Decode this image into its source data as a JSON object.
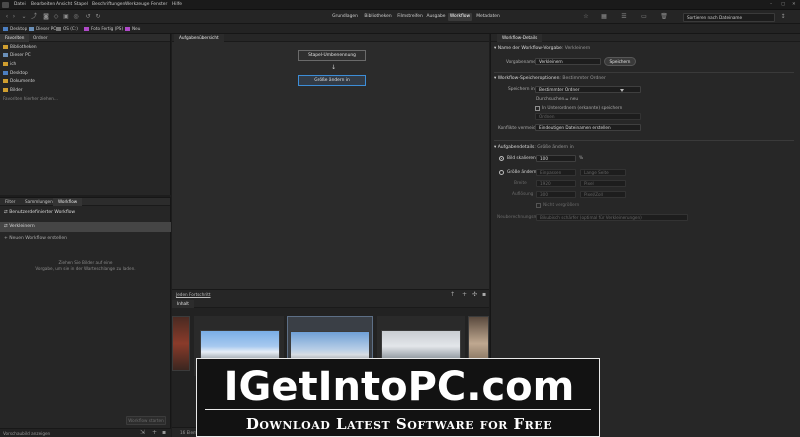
{
  "menubar": {
    "items": [
      "Datei",
      "Bearbeiten",
      "Ansicht",
      "Stapel",
      "Beschriftungen",
      "Werkzeuge",
      "Fenster",
      "Hilfe"
    ]
  },
  "toolbar": {
    "workspaces": [
      "Grundlagen",
      "Bibliotheken",
      "Filmstreifen",
      "Ausgabe",
      "Workflow",
      "Metadaten"
    ],
    "active_workspace": "Workflow",
    "sort": "Sortieren nach Dateiname"
  },
  "path": [
    "Desktop",
    "Dieser PC",
    "OS (C:)",
    "Foto Fertig (PS)",
    "Neu"
  ],
  "left_top": {
    "tabs": [
      "Favoriten",
      "Ordner"
    ],
    "favorites": [
      "Bibliotheken",
      "Dieser PC",
      "ich",
      "Desktop",
      "Dokumente",
      "Bilder"
    ],
    "hint": "Favoriten hierher ziehen..."
  },
  "left_bottom": {
    "tabs": [
      "Filter",
      "Sammlungen",
      "Workflow"
    ],
    "items": [
      "Benutzerdefinierter Workflow",
      "Verkleinern",
      "Neuen Workflow erstellen"
    ],
    "empty_text_line1": "Ziehen Sie Bilder auf eine",
    "empty_text_line2": "Vorgabe, um sie in der Warteschlange zu laden.",
    "run_button": "Workflow starten",
    "footer": "Vorschaubild anzeigen"
  },
  "center": {
    "tab": "Aufgabenübersicht",
    "nodes": [
      "Stapel-Umbenennung",
      "Größe ändern in"
    ],
    "bottom_link": "Jeden Fortschritt",
    "content_tab": "Inhalt",
    "count": "16 Elemente"
  },
  "right": {
    "tab": "Workflow-Details",
    "sec1": "Name der Workflow-Vorgabe",
    "sec1_value": ": Verkleinern",
    "preset_label": "Vorgabename",
    "preset_value": "Verkleinern",
    "save_button": "Speichern",
    "sec2": "Workflow-Speicheroptionen",
    "sec2_value": ": Bestimmter Ordner",
    "save_in_label": "Speichern in",
    "save_in_value": "Bestimmter Ordner",
    "browse_label": "Durchsuchen...",
    "browse_value": "= neu",
    "subfolder_label": "In Unterordnern (erkannte) speichern",
    "subfolder_placeholder": "Ordnen",
    "conflict_label": "Konflikte vermeiden",
    "conflict_value": "Eindeutigen Dateinamen erstellen",
    "sec3": "Aufgabendetails",
    "sec3_value": ": Größe ändern in",
    "scale_label": "Bild skalieren",
    "scale_value": "100",
    "scale_unit": "%",
    "resize_label": "Größe ändern in",
    "resize_value": "Einpassen",
    "side_value": "Lange Seite",
    "width_label": "Breite",
    "width_value": "1920",
    "width_unit": "Pixel",
    "res_label": "Auflösung",
    "res_value": "300",
    "res_unit": "Pixel/Zoll",
    "upsample_label": "Nicht vergrößern",
    "method_label": "Neuberechnungsmethode",
    "method_value": "Bikubisch schärfer (optimal für Verkleinerungen)"
  },
  "banner": {
    "title": "IGetIntoPC.com",
    "subtitle": "Download Latest Software for Free"
  },
  "colors": {
    "accent": "#3d8ed8",
    "folder": "#cf9e2f"
  }
}
